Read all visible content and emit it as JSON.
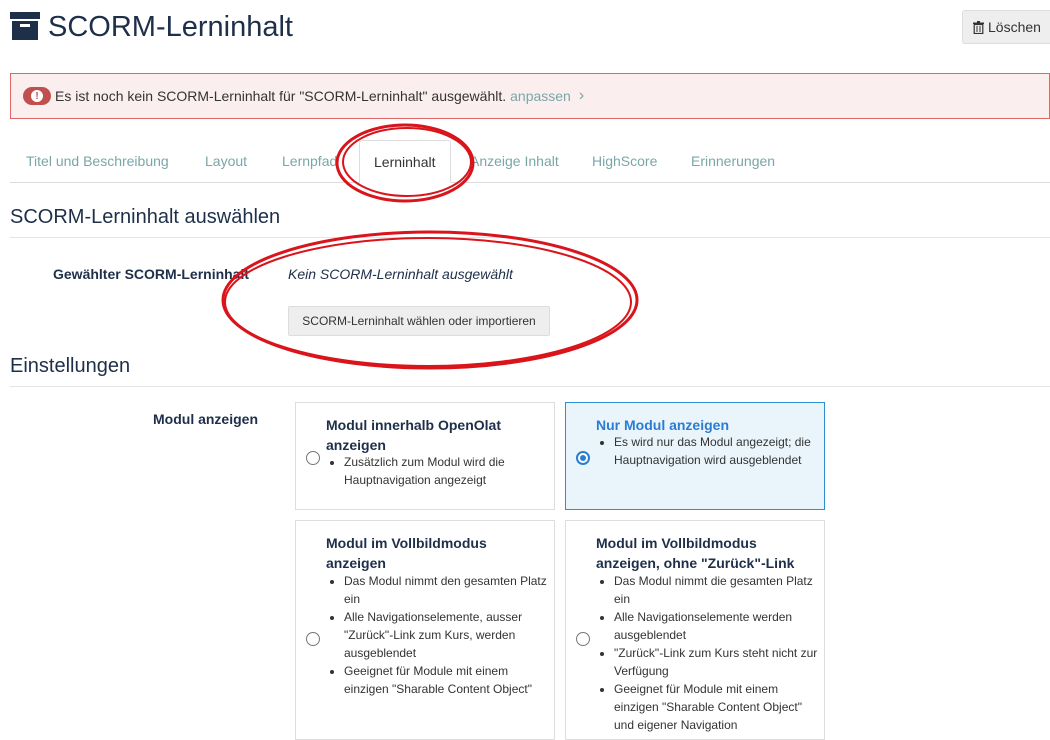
{
  "header": {
    "title": "SCORM-Lerninhalt",
    "delete_label": "Löschen"
  },
  "alert": {
    "message": "Es ist noch kein SCORM-Lerninhalt für \"SCORM-Lerninhalt\" ausgewählt.",
    "link": "anpassen"
  },
  "tabs": [
    {
      "label": "Titel und Beschreibung"
    },
    {
      "label": "Layout"
    },
    {
      "label": "Lernpfad"
    },
    {
      "label": "Lerninhalt"
    },
    {
      "label": "Anzeige Inhalt"
    },
    {
      "label": "HighScore"
    },
    {
      "label": "Erinnerungen"
    }
  ],
  "select_section": {
    "title": "SCORM-Lerninhalt auswählen",
    "field_label": "Gewählter SCORM-Lerninhalt",
    "field_value": "Kein SCORM-Lerninhalt ausgewählt",
    "button_label": "SCORM-Lerninhalt wählen oder importieren"
  },
  "settings": {
    "title": "Einstellungen",
    "module_label": "Modul anzeigen",
    "options": [
      {
        "title": "Modul innerhalb OpenOlat anzeigen",
        "bullets": [
          "Zusätzlich zum Modul wird die Hauptnavigation angezeigt"
        ],
        "selected": false
      },
      {
        "title": "Nur Modul anzeigen",
        "bullets": [
          "Es wird nur das Modul angezeigt; die Hauptnavigation wird ausgeblendet"
        ],
        "selected": true
      },
      {
        "title": "Modul im Vollbildmodus anzeigen",
        "bullets": [
          "Das Modul nimmt den gesamten Platz ein",
          "Alle Navigationselemente, ausser \"Zurück\"-Link zum Kurs, werden ausgeblendet",
          "Geeignet für Module mit einem einzigen \"Sharable Content Object\""
        ],
        "selected": false
      },
      {
        "title": "Modul im Vollbildmodus anzeigen, ohne \"Zurück\"-Link",
        "bullets": [
          "Das Modul nimmt die gesamten Platz ein",
          "Alle Navigationselemente werden ausgeblendet",
          "\"Zurück\"-Link zum Kurs steht nicht zur Verfügung",
          "Geeignet für Module mit einem einzigen \"Sharable Content Object\" und eigener Navigation"
        ],
        "selected": false
      }
    ]
  },
  "colors": {
    "accent": "#2b7cd3",
    "link": "#7aa6a8",
    "heading": "#1e2f4a",
    "alert_border": "#e06666",
    "annotation": "#d9141b"
  }
}
